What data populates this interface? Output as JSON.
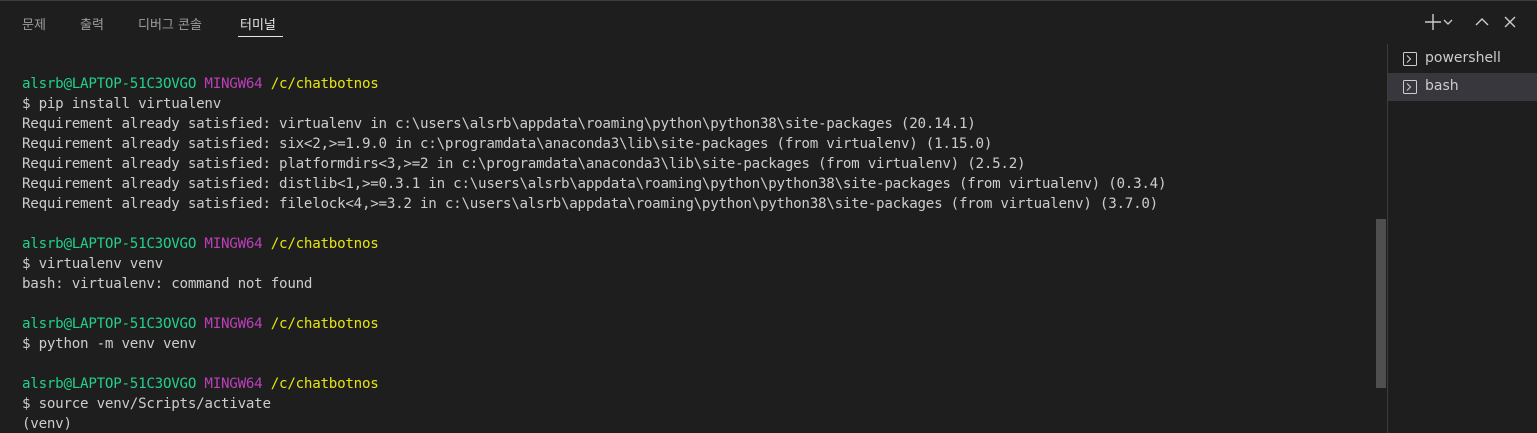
{
  "tabs": [
    {
      "label": "문제"
    },
    {
      "label": "출력"
    },
    {
      "label": "디버그 콘솔"
    },
    {
      "label": "터미널"
    }
  ],
  "active_tab": "터미널",
  "header_actions": {
    "icons": [
      "plus-icon",
      "chevron-down-icon",
      "chevron-up-icon",
      "close-icon"
    ]
  },
  "terminal": {
    "prompt": {
      "user": "alsrb@LAPTOP-51C3OVGO",
      "system": "MINGW64",
      "path": "/c/chatbotnos"
    },
    "lines": [
      {
        "type": "prompt"
      },
      {
        "type": "text",
        "text": "$ pip install virtualenv"
      },
      {
        "type": "text",
        "text": "Requirement already satisfied: virtualenv in c:\\users\\alsrb\\appdata\\roaming\\python\\python38\\site-packages (20.14.1)"
      },
      {
        "type": "text",
        "text": "Requirement already satisfied: six<2,>=1.9.0 in c:\\programdata\\anaconda3\\lib\\site-packages (from virtualenv) (1.15.0)"
      },
      {
        "type": "text",
        "text": "Requirement already satisfied: platformdirs<3,>=2 in c:\\programdata\\anaconda3\\lib\\site-packages (from virtualenv) (2.5.2)"
      },
      {
        "type": "text",
        "text": "Requirement already satisfied: distlib<1,>=0.3.1 in c:\\users\\alsrb\\appdata\\roaming\\python\\python38\\site-packages (from virtualenv) (0.3.4)"
      },
      {
        "type": "text",
        "text": "Requirement already satisfied: filelock<4,>=3.2 in c:\\users\\alsrb\\appdata\\roaming\\python\\python38\\site-packages (from virtualenv) (3.7.0)"
      },
      {
        "type": "text",
        "text": ""
      },
      {
        "type": "prompt"
      },
      {
        "type": "text",
        "text": "$ virtualenv venv"
      },
      {
        "type": "text",
        "text": "bash: virtualenv: command not found"
      },
      {
        "type": "text",
        "text": ""
      },
      {
        "type": "prompt"
      },
      {
        "type": "text",
        "text": "$ python -m venv venv"
      },
      {
        "type": "text",
        "text": ""
      },
      {
        "type": "prompt"
      },
      {
        "type": "text",
        "text": "$ source venv/Scripts/activate"
      },
      {
        "type": "text",
        "text": "(venv)"
      }
    ]
  },
  "terminal_list": [
    {
      "label": "powershell",
      "icon": "terminal-icon",
      "selected": false
    },
    {
      "label": "bash",
      "icon": "terminal-icon",
      "selected": true
    }
  ],
  "colors": {
    "background": "#1e1e1e",
    "prompt_user": "#23d18b",
    "prompt_system": "#bc3fbc",
    "prompt_path": "#e5e510",
    "text": "#cccccc"
  }
}
